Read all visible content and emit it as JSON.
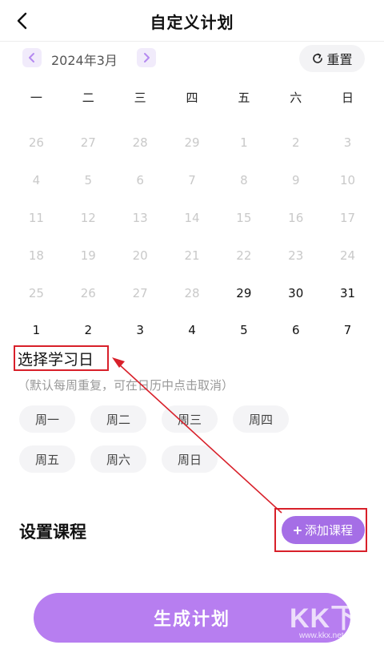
{
  "header": {
    "title": "自定义计划"
  },
  "month": {
    "label": "2024年3月"
  },
  "reset": {
    "label": "重置"
  },
  "weekdays": [
    "一",
    "二",
    "三",
    "四",
    "五",
    "六",
    "日"
  ],
  "calendar": {
    "days": [
      {
        "n": "26",
        "active": false
      },
      {
        "n": "27",
        "active": false
      },
      {
        "n": "28",
        "active": false
      },
      {
        "n": "29",
        "active": false
      },
      {
        "n": "1",
        "active": false
      },
      {
        "n": "2",
        "active": false
      },
      {
        "n": "3",
        "active": false
      },
      {
        "n": "4",
        "active": false
      },
      {
        "n": "5",
        "active": false
      },
      {
        "n": "6",
        "active": false
      },
      {
        "n": "7",
        "active": false
      },
      {
        "n": "8",
        "active": false
      },
      {
        "n": "9",
        "active": false
      },
      {
        "n": "10",
        "active": false
      },
      {
        "n": "11",
        "active": false
      },
      {
        "n": "12",
        "active": false
      },
      {
        "n": "13",
        "active": false
      },
      {
        "n": "14",
        "active": false
      },
      {
        "n": "15",
        "active": false
      },
      {
        "n": "16",
        "active": false
      },
      {
        "n": "17",
        "active": false
      },
      {
        "n": "18",
        "active": false
      },
      {
        "n": "19",
        "active": false
      },
      {
        "n": "20",
        "active": false
      },
      {
        "n": "21",
        "active": false
      },
      {
        "n": "22",
        "active": false
      },
      {
        "n": "23",
        "active": false
      },
      {
        "n": "24",
        "active": false
      },
      {
        "n": "25",
        "active": false
      },
      {
        "n": "26",
        "active": false
      },
      {
        "n": "27",
        "active": false
      },
      {
        "n": "28",
        "active": false
      },
      {
        "n": "29",
        "active": true
      },
      {
        "n": "30",
        "active": true
      },
      {
        "n": "31",
        "active": true
      },
      {
        "n": "1",
        "active": true
      },
      {
        "n": "2",
        "active": true
      },
      {
        "n": "3",
        "active": true
      },
      {
        "n": "4",
        "active": true
      },
      {
        "n": "5",
        "active": true
      },
      {
        "n": "6",
        "active": true
      },
      {
        "n": "7",
        "active": true
      }
    ]
  },
  "study_days": {
    "title": "选择学习日",
    "hint": "（默认每周重复，可在日历中点击取消）",
    "chips": [
      "周一",
      "周二",
      "周三",
      "周四",
      "周五",
      "周六",
      "周日"
    ]
  },
  "course": {
    "title": "设置课程",
    "add_label": "添加课程"
  },
  "generate": {
    "label": "生成计划"
  },
  "watermark": {
    "main": "KK下载",
    "sub": "www.kkx.net"
  },
  "colors": {
    "accent": "#a56ee6",
    "annotation": "#d8202a",
    "faded_text": "#c9c9c9"
  },
  "icons": {
    "back": "chevron-left-icon",
    "prev": "chevron-left-icon",
    "next": "chevron-right-icon",
    "reset": "refresh-icon",
    "add": "plus-icon"
  }
}
